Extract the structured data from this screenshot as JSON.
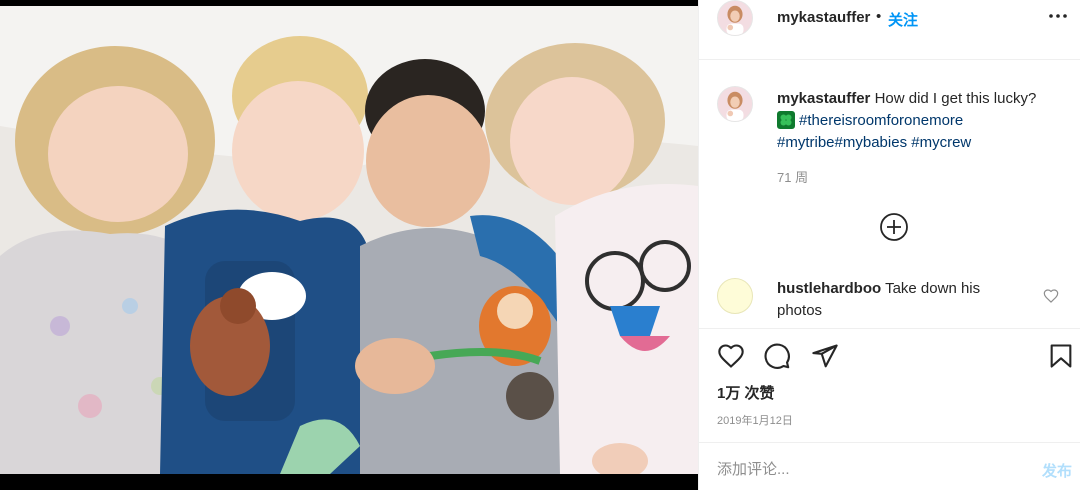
{
  "header": {
    "username": "mykastauffer",
    "separator": "•",
    "follow_label": "关注",
    "more_icon": "more-horizontal-icon"
  },
  "caption": {
    "username": "mykastauffer",
    "text": "How did I get this lucky?",
    "emoji_icon": "four-leaf-clover-icon",
    "hashtag_1": "#thereisroomforonemore",
    "hashtag_2": "#mytribe",
    "hashtag_3": "#mybabies",
    "hashtag_4": "#mycrew",
    "age": "71 周",
    "load_more_icon": "plus-circle-icon"
  },
  "comments": [
    {
      "username": "hustlehardboo",
      "text": "Take down his photos",
      "like_icon": "heart-outline-icon"
    }
  ],
  "actions": {
    "like_icon": "heart-icon",
    "comment_icon": "comment-icon",
    "share_icon": "paper-plane-icon",
    "save_icon": "bookmark-icon"
  },
  "likes_label": "1万 次赞",
  "date_label": "2019年1月12日",
  "add_comment": {
    "placeholder": "添加评论...",
    "post_label": "发布"
  },
  "colors": {
    "accent": "#0095f6",
    "post_disabled": "#b2dffc",
    "hashtag": "#00376b",
    "muted": "#8e8e8e"
  }
}
